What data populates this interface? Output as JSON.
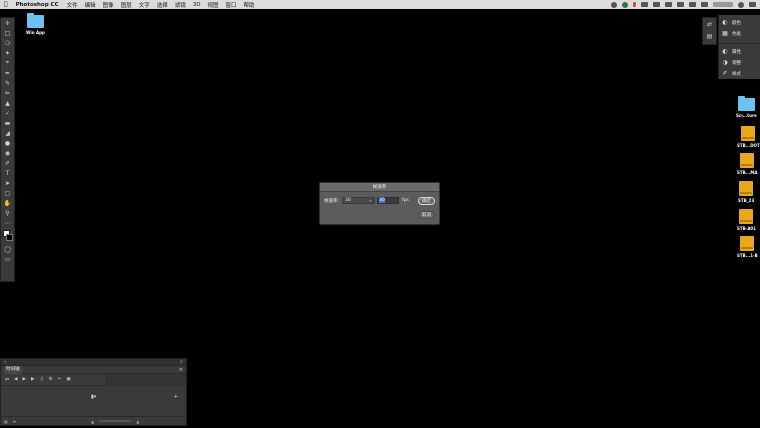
{
  "menubar": {
    "app_name": "Photoshop CC",
    "items": [
      "文件",
      "编辑",
      "图像",
      "图层",
      "文字",
      "选择",
      "滤镜",
      "3D",
      "视图",
      "窗口",
      "帮助"
    ]
  },
  "desktop": {
    "top_folder": "Win App",
    "right_items": [
      "Scr...ture",
      "STB...DOT",
      "STB...MA",
      "STB_23",
      "STB-A01",
      "STB...1-B"
    ]
  },
  "tools": [
    "move-icon",
    "marquee-icon",
    "lasso-icon",
    "magic-wand-icon",
    "crop-icon",
    "eyedropper-icon",
    "healing-icon",
    "brush-icon",
    "stamp-icon",
    "history-brush-icon",
    "eraser-icon",
    "gradient-icon",
    "blur-icon",
    "dodge-icon",
    "pen-icon",
    "type-icon",
    "path-select-icon",
    "rectangle-icon",
    "hand-icon",
    "zoom-icon",
    "more-icon",
    "colors-icon",
    "quickmask-icon",
    "screenmode-icon"
  ],
  "right_panel": {
    "items": [
      {
        "label": "颜色",
        "icon": "color-icon"
      },
      {
        "label": "色板",
        "icon": "swatches-icon"
      },
      {
        "label": "属性",
        "icon": "properties-icon"
      },
      {
        "label": "调整",
        "icon": "adjustments-icon"
      },
      {
        "label": "样式",
        "icon": "styles-icon"
      }
    ]
  },
  "dialog": {
    "title": "帧速率",
    "label": "帧速率:",
    "select_value": "30",
    "input_value": "30",
    "unit": "fps",
    "ok_label": "确定",
    "cancel_label": "取消"
  },
  "timeline": {
    "tab": "时间轴"
  }
}
